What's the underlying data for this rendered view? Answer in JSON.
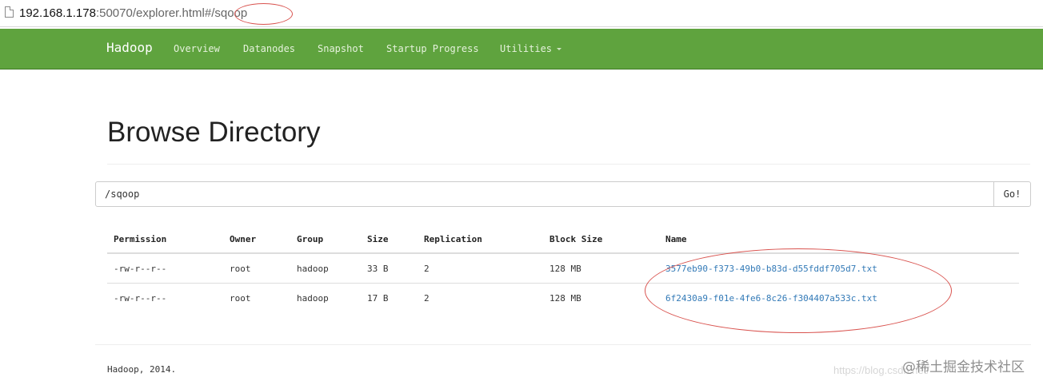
{
  "address_bar": {
    "url_host": "192.168.1.178",
    "url_rest": ":50070/explorer.html#",
    "url_fragment": "/sqoop"
  },
  "navbar": {
    "brand": "Hadoop",
    "items": [
      {
        "label": "Overview"
      },
      {
        "label": "Datanodes"
      },
      {
        "label": "Snapshot"
      },
      {
        "label": "Startup Progress"
      },
      {
        "label": "Utilities"
      }
    ]
  },
  "page": {
    "title": "Browse Directory",
    "path_value": "/sqoop",
    "go_label": "Go!"
  },
  "table": {
    "headers": [
      "Permission",
      "Owner",
      "Group",
      "Size",
      "Replication",
      "Block Size",
      "Name"
    ],
    "rows": [
      {
        "permission": "-rw-r--r--",
        "owner": "root",
        "group": "hadoop",
        "size": "33 B",
        "replication": "2",
        "block_size": "128 MB",
        "name": "3577eb90-f373-49b0-b83d-d55fddf705d7.txt"
      },
      {
        "permission": "-rw-r--r--",
        "owner": "root",
        "group": "hadoop",
        "size": "17 B",
        "replication": "2",
        "block_size": "128 MB",
        "name": "6f2430a9-f01e-4fe6-8c26-f304407a533c.txt"
      }
    ]
  },
  "footer": {
    "text": "Hadoop, 2014."
  },
  "watermark": {
    "url_text": "https://blog.csdn.net/",
    "site": "@稀土掘金技术社区"
  },
  "colors": {
    "navbar": "#5fa33e",
    "link": "#337ab7",
    "annotation": "#d9534f"
  }
}
